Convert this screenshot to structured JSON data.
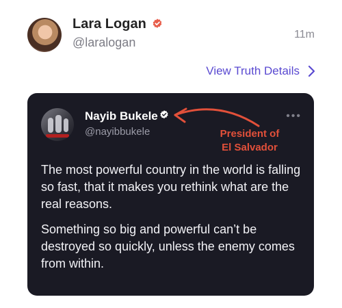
{
  "post": {
    "author": {
      "name": "Lara Logan",
      "handle": "@laralogan",
      "verified": true,
      "verified_badge_color": "#e85d4a"
    },
    "time": "11m",
    "view_details_label": "View Truth Details"
  },
  "quoted_post": {
    "author": {
      "name": "Nayib Bukele",
      "handle": "@nayibbukele",
      "verified": true
    },
    "annotation_lines": [
      "President of",
      "El Salvador"
    ],
    "annotation_color": "#e2503a",
    "body_paragraphs": [
      "The most powerful country in the world is falling so fast, that it makes you rethink what are the real reasons.",
      "Something so big and powerful can’t be destroyed so quickly, unless the enemy comes from within."
    ]
  },
  "colors": {
    "card_background": "#1a1a24",
    "link": "#5a4ad1"
  },
  "icons": {
    "verified": "verified-badge-icon",
    "chevron": "chevron-right-icon",
    "more": "more-options-icon"
  }
}
